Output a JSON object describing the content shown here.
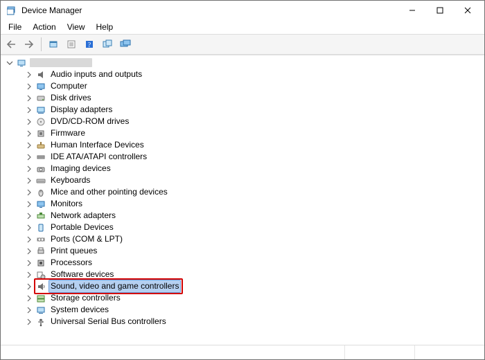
{
  "window": {
    "title": "Device Manager"
  },
  "menu": {
    "file": "File",
    "action": "Action",
    "view": "View",
    "help": "Help"
  },
  "toolbar_icons": {
    "back": "back-icon",
    "forward": "forward-icon",
    "show_hidden": "show-hidden-icon",
    "properties": "properties-icon",
    "help": "help-icon",
    "refresh": "refresh-icon",
    "screens": "screens-icon"
  },
  "tree": {
    "root": {
      "label": "",
      "expanded": true
    },
    "items": [
      {
        "label": "Audio inputs and outputs",
        "icon": "speaker-icon"
      },
      {
        "label": "Computer",
        "icon": "monitor-icon"
      },
      {
        "label": "Disk drives",
        "icon": "disk-icon"
      },
      {
        "label": "Display adapters",
        "icon": "display-adapter-icon"
      },
      {
        "label": "DVD/CD-ROM drives",
        "icon": "optical-drive-icon"
      },
      {
        "label": "Firmware",
        "icon": "firmware-icon"
      },
      {
        "label": "Human Interface Devices",
        "icon": "hid-icon"
      },
      {
        "label": "IDE ATA/ATAPI controllers",
        "icon": "ide-icon"
      },
      {
        "label": "Imaging devices",
        "icon": "camera-icon"
      },
      {
        "label": "Keyboards",
        "icon": "keyboard-icon"
      },
      {
        "label": "Mice and other pointing devices",
        "icon": "mouse-icon"
      },
      {
        "label": "Monitors",
        "icon": "monitor-icon"
      },
      {
        "label": "Network adapters",
        "icon": "network-icon"
      },
      {
        "label": "Portable Devices",
        "icon": "portable-icon"
      },
      {
        "label": "Ports (COM & LPT)",
        "icon": "port-icon"
      },
      {
        "label": "Print queues",
        "icon": "printer-icon"
      },
      {
        "label": "Processors",
        "icon": "cpu-icon"
      },
      {
        "label": "Software devices",
        "icon": "software-icon"
      },
      {
        "label": "Sound, video and game controllers",
        "icon": "sound-icon",
        "selected": true,
        "highlighted": true
      },
      {
        "label": "Storage controllers",
        "icon": "storage-icon"
      },
      {
        "label": "System devices",
        "icon": "system-icon"
      },
      {
        "label": "Universal Serial Bus controllers",
        "icon": "usb-icon"
      }
    ]
  }
}
